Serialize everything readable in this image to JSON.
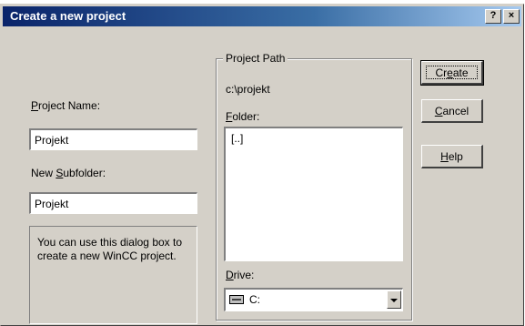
{
  "window": {
    "title": "Create a new project",
    "help_button": "?",
    "close_button": "×"
  },
  "project_name": {
    "label_accel": "P",
    "label_rest": "roject Name:",
    "value": "Projekt"
  },
  "subfolder": {
    "label_pre": "New ",
    "label_accel": "S",
    "label_rest": "ubfolder:",
    "value": "Projekt"
  },
  "info_text": "You can use this dialog box to create a new WinCC project.",
  "project_path": {
    "legend": "Project Path",
    "path": "c:\\projekt",
    "folder_label_accel": "F",
    "folder_label_rest": "older:",
    "folder_items": [
      "[..]"
    ],
    "drive_label_accel": "D",
    "drive_label_rest": "rive:",
    "drive_value": "C:",
    "drive_icon": "drive-icon"
  },
  "buttons": {
    "create_pre": "Cr",
    "create_accel": "e",
    "create_rest": "ate",
    "cancel_accel": "C",
    "cancel_rest": "ancel",
    "help_accel": "H",
    "help_rest": "elp"
  },
  "colors": {
    "dialog_bg": "#d4d0c8",
    "title_start": "#0a246a",
    "title_end": "#a6caf0"
  }
}
